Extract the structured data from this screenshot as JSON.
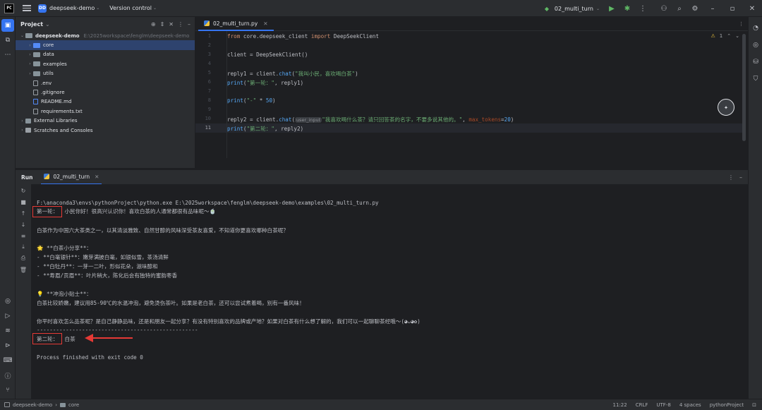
{
  "titlebar": {
    "logo": "PC",
    "project_initials": "DD",
    "project_name": "deepseek-demo",
    "vcs": "Version control",
    "run_config": "02_multi_turn",
    "icons": [
      "run-icon",
      "debug-icon",
      "more-icon",
      "add-user-icon",
      "search-icon",
      "settings-icon",
      "minimize-icon",
      "restore-icon",
      "close-icon"
    ]
  },
  "project_panel": {
    "title": "Project",
    "root": {
      "name": "deepseek-demo",
      "path": "E:\\2025workspace\\fenglm\\deepseek-demo"
    },
    "items": [
      {
        "label": "core",
        "kind": "folder"
      },
      {
        "label": "data",
        "kind": "folder"
      },
      {
        "label": "examples",
        "kind": "folder"
      },
      {
        "label": "utils",
        "kind": "folder"
      },
      {
        "label": ".env",
        "kind": "file"
      },
      {
        "label": ".gitignore",
        "kind": "file"
      },
      {
        "label": "README.md",
        "kind": "file"
      },
      {
        "label": "requirements.txt",
        "kind": "file"
      }
    ],
    "external": "External Libraries",
    "scratches": "Scratches and Consoles"
  },
  "editor": {
    "tab": "02_multi_turn.py",
    "warning_count": "1",
    "line_numbers": [
      "1",
      "2",
      "3",
      "4",
      "5",
      "6",
      "7",
      "8",
      "9",
      "10",
      "11"
    ],
    "current_line": "11",
    "code": {
      "l1_kw1": "from",
      "l1_mod": " core.deepseek_client ",
      "l1_kw2": "import",
      "l1_cls": " DeepSeekClient",
      "l3": "client = DeepSeekClient()",
      "l5_a": "reply1 = client.",
      "l5_fn": "chat",
      "l5_b": "(",
      "l5_str": "\"我叫小民，喜欢喝白茶\"",
      "l5_c": ")",
      "l6_fn": "print",
      "l6_a": "(",
      "l6_str": "\"第一轮：\"",
      "l6_b": ", reply1)",
      "l8_fn": "print",
      "l8_a": "(",
      "l8_str": "\"-\"",
      "l8_b": " * ",
      "l8_num": "50",
      "l8_c": ")",
      "l10_a": "reply2 = client.",
      "l10_fn": "chat",
      "l10_b": "(",
      "l10_hint": "user_input",
      "l10_str": "\"我喜欢喝什么茶？请只回答茶的名字，不要多说其他的。\"",
      "l10_c": ", ",
      "l10_param": "max_tokens",
      "l10_d": "=",
      "l10_num": "20",
      "l10_e": ")",
      "l11_fn": "print",
      "l11_a": "(",
      "l11_str": "\"第二轮：\"",
      "l11_b": ", reply2)"
    }
  },
  "run_panel": {
    "title": "Run",
    "tab": "02_multi_turn",
    "console": [
      "F:\\anaconda3\\envs\\pythonProject\\python.exe E:\\2025workspace\\fenglm\\deepseek-demo\\examples\\02_multi_turn.py",
      "第一轮：  小民你好！很高兴认识你！喜欢白茶的人通常都很有品味呢～🍵",
      "",
      "白茶作为中国六大茶类之一，以其清淡雅致、自然甘醇的风味深受茶友喜爱，不知道你更喜欢哪种白茶呢？",
      "",
      "🌟 **白茶小分享**：",
      "- **白毫银针**：嫩芽满披白毫，如银似雪，茶汤清鲜",
      "- **白牡丹**：一芽一二叶，形似花朵，滋味醇和",
      "- **寿眉/贡眉**：叶片稍大，陈化后会有独特的蜜韵枣香",
      "",
      "💡 **冲泡小贴士**：",
      "白茶比较娇嫩，建议用85-90℃的水温冲泡，避免烫伤茶叶。如果是老白茶，还可以尝试煮着喝，别有一番风味！",
      "",
      "你平时喜欢怎么品茶呢？是自己静静品味，还是和朋友一起分享？有没有特别喜欢的品牌或产地？如果对白茶有什么想了解的，我们可以一起聊聊茶经哦～(◕ᴗ◕✿)",
      "--------------------------------------------------",
      "第二轮：  白茶",
      "",
      "Process finished with exit code 0"
    ]
  },
  "statusbar": {
    "project": "deepseek-demo",
    "folder": "core",
    "position": "11:22",
    "line_sep": "CRLF",
    "encoding": "UTF-8",
    "indent": "4 spaces",
    "interpreter": "pythonProject"
  },
  "colors": {
    "accent": "#3574f0",
    "highlight_box": "#e53935",
    "keyword": "#cf8e6d",
    "string": "#6aab73"
  }
}
